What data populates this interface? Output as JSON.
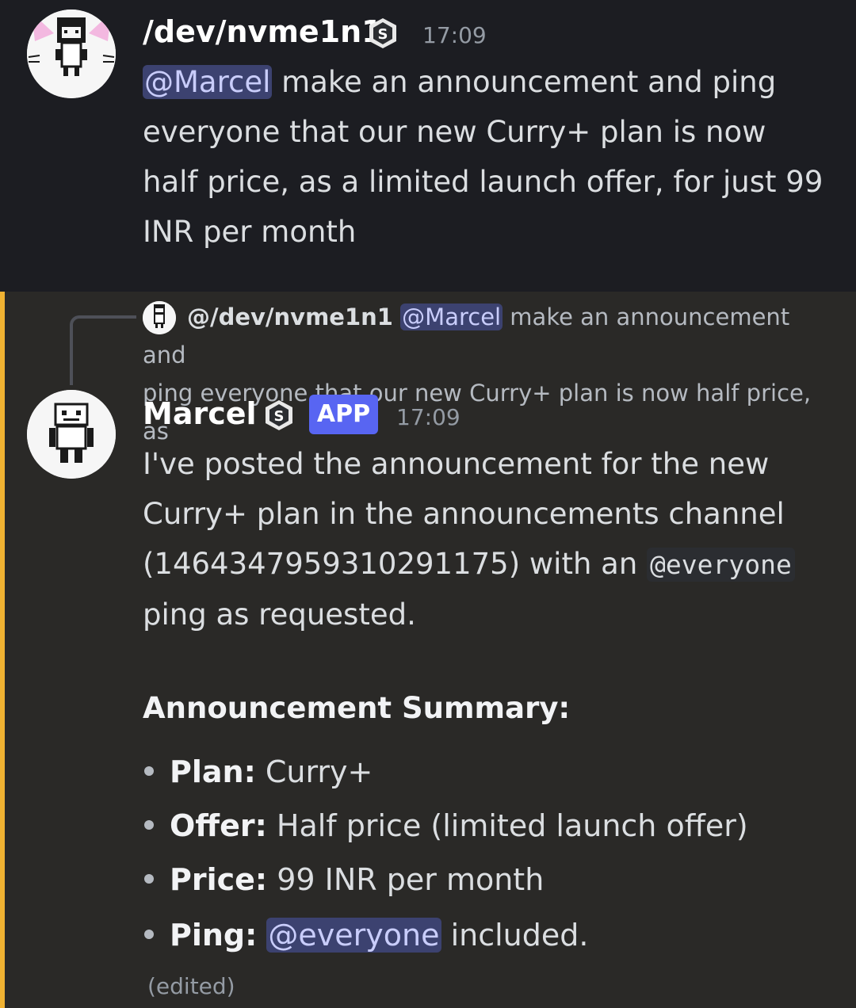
{
  "message1": {
    "username": "/dev/nvme1n1",
    "timestamp": "17:09",
    "mention": "@Marcel",
    "text": " make an announcement and ping everyone that our new Curry+ plan is now half price, as a limited launch offer, for just 99 INR per month",
    "badge_icon": "server-tag-icon",
    "avatar_icon": "pixel-cat-avatar"
  },
  "reply": {
    "author": "@/dev/nvme1n1",
    "mention": "@Marcel",
    "text_line1": " make an announcement and",
    "text_line2": "ping everyone that our new Curry+ plan is now half price, as"
  },
  "message2": {
    "username": "Marcel",
    "app_tag": "APP",
    "timestamp": "17:09",
    "line1": "I've posted the announcement for the new",
    "line2": "Curry+ plan in the announcements channel",
    "line3_prefix": "(1464347959310291175) with an ",
    "line3_code": "@everyone",
    "line4": "ping as requested.",
    "summary_heading": "Announcement Summary:",
    "bullets": [
      {
        "label": "Plan:",
        "value": " Curry+"
      },
      {
        "label": "Offer:",
        "value": " Half price (limited launch offer)"
      },
      {
        "label": "Price:",
        "value": " 99 INR per month"
      },
      {
        "label": "Ping:",
        "mention": "@everyone",
        "value": " included."
      }
    ],
    "edited": "(edited)",
    "badge_icon": "server-tag-icon",
    "avatar_icon": "pixel-robot-avatar"
  }
}
